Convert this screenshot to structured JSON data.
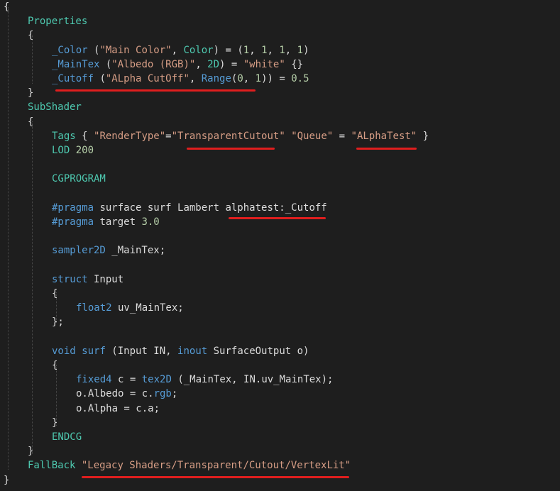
{
  "editor": {
    "lines": [
      [
        {
          "t": "{",
          "c": "punc"
        }
      ],
      [
        {
          "t": "Properties",
          "c": "prop"
        }
      ],
      [
        {
          "t": "{",
          "c": "punc"
        }
      ],
      [
        {
          "t": "_Color",
          "c": "kw"
        },
        {
          "t": " (",
          "c": "punc"
        },
        {
          "t": "\"Main Color\"",
          "c": "str"
        },
        {
          "t": ", ",
          "c": "punc"
        },
        {
          "t": "Color",
          "c": "prop"
        },
        {
          "t": ") = (",
          "c": "punc"
        },
        {
          "t": "1",
          "c": "num"
        },
        {
          "t": ", ",
          "c": "punc"
        },
        {
          "t": "1",
          "c": "num"
        },
        {
          "t": ", ",
          "c": "punc"
        },
        {
          "t": "1",
          "c": "num"
        },
        {
          "t": ", ",
          "c": "punc"
        },
        {
          "t": "1",
          "c": "num"
        },
        {
          "t": ")",
          "c": "punc"
        }
      ],
      [
        {
          "t": "_MainTex",
          "c": "kw"
        },
        {
          "t": " (",
          "c": "punc"
        },
        {
          "t": "\"Albedo (RGB)\"",
          "c": "str"
        },
        {
          "t": ", ",
          "c": "punc"
        },
        {
          "t": "2D",
          "c": "prop"
        },
        {
          "t": ") = ",
          "c": "punc"
        },
        {
          "t": "\"white\"",
          "c": "str"
        },
        {
          "t": " {}",
          "c": "punc"
        }
      ],
      [
        {
          "t": "_Cutoff",
          "c": "kw"
        },
        {
          "t": " (",
          "c": "punc"
        },
        {
          "t": "\"ALpha CutOff\"",
          "c": "str"
        },
        {
          "t": ", ",
          "c": "punc"
        },
        {
          "t": "Range",
          "c": "kw"
        },
        {
          "t": "(",
          "c": "punc"
        },
        {
          "t": "0",
          "c": "num"
        },
        {
          "t": ", ",
          "c": "punc"
        },
        {
          "t": "1",
          "c": "num"
        },
        {
          "t": ")) = ",
          "c": "punc"
        },
        {
          "t": "0.5",
          "c": "num"
        }
      ],
      [
        {
          "t": "}",
          "c": "punc"
        }
      ],
      [
        {
          "t": "SubShader",
          "c": "prop"
        }
      ],
      [
        {
          "t": "{",
          "c": "punc"
        }
      ],
      [
        {
          "t": "Tags",
          "c": "prop"
        },
        {
          "t": " { ",
          "c": "punc"
        },
        {
          "t": "\"RenderType\"",
          "c": "str"
        },
        {
          "t": "=",
          "c": "punc"
        },
        {
          "t": "\"TransparentCutout\"",
          "c": "str"
        },
        {
          "t": " ",
          "c": "punc"
        },
        {
          "t": "\"Queue\"",
          "c": "str"
        },
        {
          "t": " = ",
          "c": "punc"
        },
        {
          "t": "\"ALphaTest\"",
          "c": "str"
        },
        {
          "t": " }",
          "c": "punc"
        }
      ],
      [
        {
          "t": "LOD",
          "c": "prop"
        },
        {
          "t": " ",
          "c": "punc"
        },
        {
          "t": "200",
          "c": "num"
        }
      ],
      [],
      [
        {
          "t": "CGPROGRAM",
          "c": "prop"
        }
      ],
      [],
      [
        {
          "t": "#pragma",
          "c": "kw"
        },
        {
          "t": " surface surf Lambert alphatest:_Cutoff",
          "c": "plain"
        }
      ],
      [
        {
          "t": "#pragma",
          "c": "kw"
        },
        {
          "t": " target ",
          "c": "plain"
        },
        {
          "t": "3.0",
          "c": "num"
        }
      ],
      [],
      [
        {
          "t": "sampler2D",
          "c": "kw"
        },
        {
          "t": " _MainTex;",
          "c": "plain"
        }
      ],
      [],
      [
        {
          "t": "struct",
          "c": "kw"
        },
        {
          "t": " Input",
          "c": "plain"
        }
      ],
      [
        {
          "t": "{",
          "c": "punc"
        }
      ],
      [
        {
          "t": "float2",
          "c": "kw"
        },
        {
          "t": " uv_MainTex;",
          "c": "plain"
        }
      ],
      [
        {
          "t": "};",
          "c": "punc"
        }
      ],
      [],
      [
        {
          "t": "void",
          "c": "kw"
        },
        {
          "t": " ",
          "c": "plain"
        },
        {
          "t": "surf",
          "c": "kw"
        },
        {
          "t": " (Input IN, ",
          "c": "plain"
        },
        {
          "t": "inout",
          "c": "kw"
        },
        {
          "t": " SurfaceOutput o)",
          "c": "plain"
        }
      ],
      [
        {
          "t": "{",
          "c": "punc"
        }
      ],
      [
        {
          "t": "fixed4",
          "c": "kw"
        },
        {
          "t": " c = ",
          "c": "plain"
        },
        {
          "t": "tex2D",
          "c": "kw"
        },
        {
          "t": " (_MainTex, IN.uv_MainTex);",
          "c": "plain"
        }
      ],
      [
        {
          "t": "o.Albedo = c.",
          "c": "plain"
        },
        {
          "t": "rgb",
          "c": "kw"
        },
        {
          "t": ";",
          "c": "plain"
        }
      ],
      [
        {
          "t": "o.Alpha = c.a;",
          "c": "plain"
        }
      ],
      [
        {
          "t": "}",
          "c": "punc"
        }
      ],
      [
        {
          "t": "ENDCG",
          "c": "prop"
        }
      ],
      [
        {
          "t": "}",
          "c": "punc"
        }
      ],
      [
        {
          "t": "FallBack",
          "c": "prop"
        },
        {
          "t": " ",
          "c": "punc"
        },
        {
          "t": "\"Legacy Shaders/Transparent/Cutout/VertexLit\"",
          "c": "str"
        }
      ],
      [
        {
          "t": "}",
          "c": "punc"
        }
      ]
    ]
  }
}
